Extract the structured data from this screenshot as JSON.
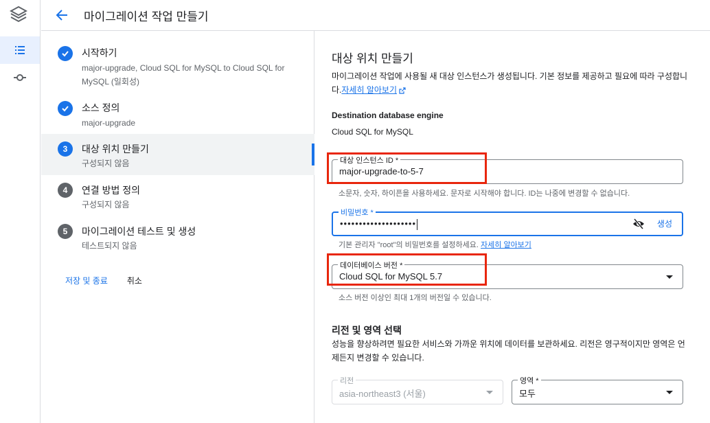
{
  "header": {
    "title": "마이그레이션 작업 만들기"
  },
  "steps": [
    {
      "number": "",
      "title": "시작하기",
      "subtitle": "major-upgrade, Cloud SQL for MySQL to Cloud SQL for MySQL (일회성)",
      "state": "done"
    },
    {
      "number": "",
      "title": "소스 정의",
      "subtitle": "major-upgrade",
      "state": "done"
    },
    {
      "number": "3",
      "title": "대상 위치 만들기",
      "subtitle": "구성되지 않음",
      "state": "current"
    },
    {
      "number": "4",
      "title": "연결 방법 정의",
      "subtitle": "구성되지 않음",
      "state": "todo"
    },
    {
      "number": "5",
      "title": "마이그레이션 테스트 및 생성",
      "subtitle": "테스트되지 않음",
      "state": "todo"
    }
  ],
  "actions": {
    "save_exit": "저장 및 종료",
    "cancel": "취소"
  },
  "main": {
    "title": "대상 위치 만들기",
    "description": "마이그레이션 작업에 사용될 새 대상 인스턴스가 생성됩니다. 기본 정보를 제공하고 필요에 따라 구성합니다.",
    "learn_more": "자세히 알아보기",
    "engine_label": "Destination database engine",
    "engine_value": "Cloud SQL for MySQL",
    "instance_id": {
      "label": "대상 인스턴스 ID *",
      "value": "major-upgrade-to-5-7",
      "hint": "소문자, 숫자, 하이픈을 사용하세요. 문자로 시작해야 합니다. ID는 나중에 변경할 수 없습니다."
    },
    "password": {
      "label": "비밀번호 *",
      "value": "••••••••••••••••••••",
      "generate": "생성",
      "hint": "기본 관리자 \"root\"의 비밀번호를 설정하세요.",
      "hint_link": "자세히 알아보기"
    },
    "db_version": {
      "label": "데이터베이스 버전 *",
      "value": "Cloud SQL for MySQL 5.7",
      "hint": "소스 버전 이상인 최대 1개의 버전일 수 있습니다."
    },
    "region_section": {
      "title": "리전 및 영역 선택",
      "description": "성능을 향상하려면 필요한 서비스와 가까운 위치에 데이터를 보관하세요. 리전은 영구적이지만 영역은 언제든지 변경할 수 있습니다."
    },
    "region": {
      "label": "리전",
      "value": "asia-northeast3 (서울)"
    },
    "zone": {
      "label": "영역 *",
      "value": "모두"
    }
  },
  "colors": {
    "accent": "#1a73e8",
    "highlight": "#e8260c"
  }
}
